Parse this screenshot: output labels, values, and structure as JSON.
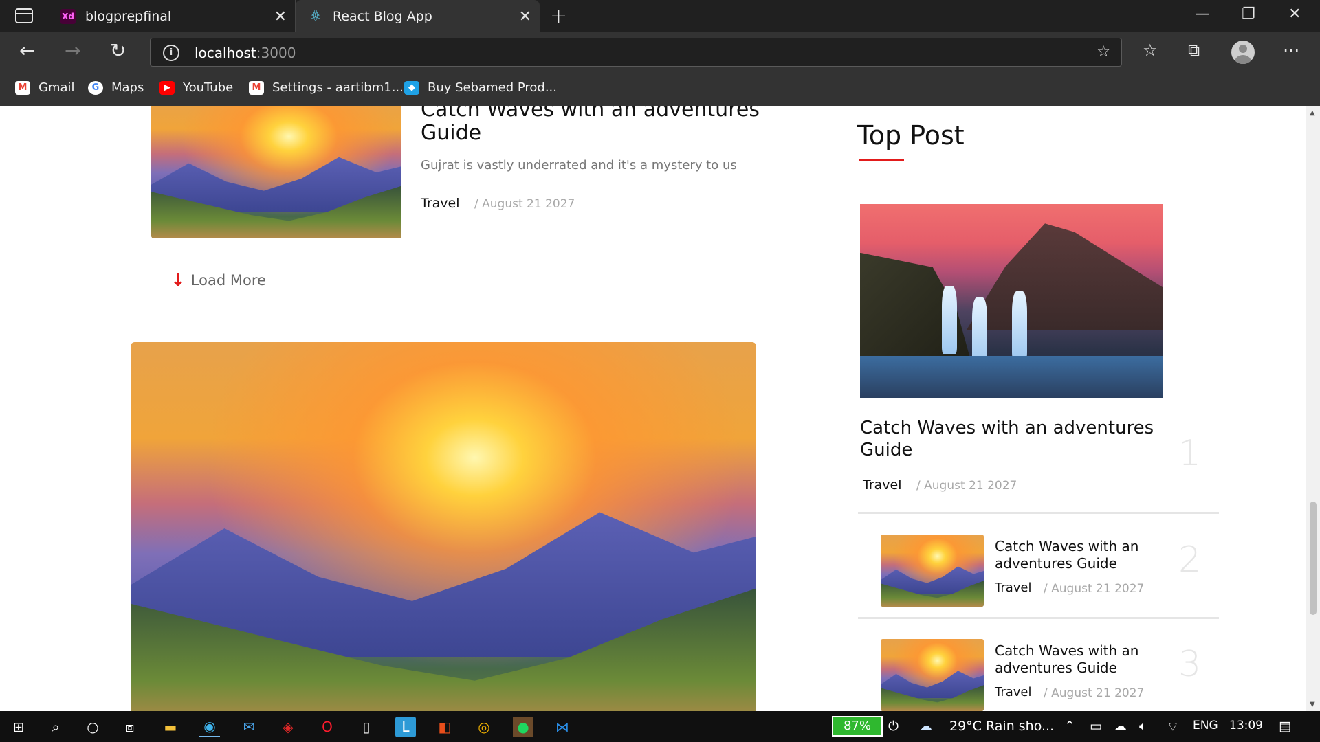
{
  "browser": {
    "tabs": [
      {
        "label": "blogprepfinal",
        "favicon": "Xd"
      },
      {
        "label": "React Blog App",
        "favicon": "react-icon"
      }
    ],
    "address": {
      "host": "localhost",
      "port": ":3000"
    },
    "bookmarks": [
      {
        "label": "Gmail",
        "icon": "gmail-icon"
      },
      {
        "label": "Maps",
        "icon": "google-icon"
      },
      {
        "label": "YouTube",
        "icon": "youtube-icon"
      },
      {
        "label": "Settings - aartibm1...",
        "icon": "gmail-icon"
      },
      {
        "label": "Buy Sebamed Prod...",
        "icon": "sebamed-icon"
      }
    ]
  },
  "main": {
    "top_post": {
      "title": "Catch Waves with an adventures Guide",
      "excerpt": "Gujrat is vastly underrated and it's a mystery to us",
      "category": "Travel",
      "date": "/ August 21 2027"
    },
    "load_more": "Load More"
  },
  "sidebar": {
    "section_title": "Top Post",
    "featured": {
      "title": "Catch Waves with an adventures Guide",
      "category": "Travel",
      "date": "/ August 21 2027",
      "rank": "1"
    },
    "items": [
      {
        "title": "Catch Waves with an adventures Guide",
        "category": "Travel",
        "date": "/ August 21 2027",
        "rank": "2"
      },
      {
        "title": "Catch Waves with an adventures Guide",
        "category": "Travel",
        "date": "/ August 21 2027",
        "rank": "3"
      }
    ]
  },
  "taskbar": {
    "battery": "87%",
    "weather": "29°C  Rain sho...",
    "language": "ENG",
    "time": "13:09"
  },
  "colors": {
    "accent": "#e21b1b",
    "chrome_dark": "#202020",
    "chrome_mid": "#333333"
  }
}
